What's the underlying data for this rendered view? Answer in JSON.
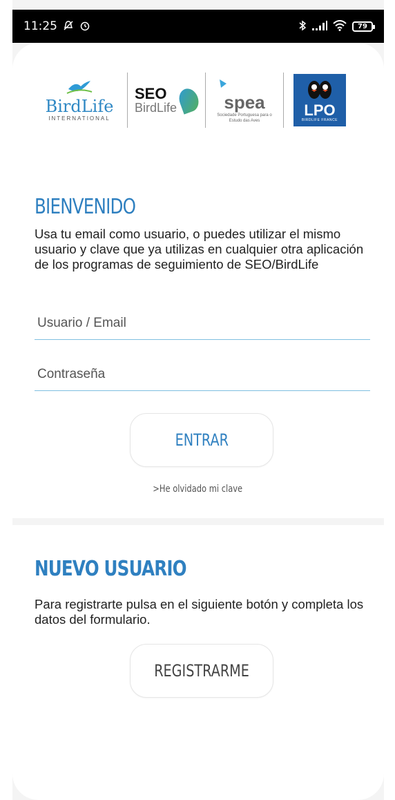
{
  "status_bar": {
    "time": "11:25",
    "battery": "79",
    "icons": [
      "silent-icon",
      "alarm-icon",
      "bluetooth-icon",
      "signal-icon",
      "wifi-icon",
      "battery-icon"
    ]
  },
  "logos": {
    "birdlife": {
      "name": "BirdLife",
      "sub": "INTERNATIONAL"
    },
    "seo": {
      "name": "SEO",
      "sub": "BirdLife"
    },
    "spea": {
      "name": "spea",
      "sub": "Sociedade Portuguesa para o Estudo das Aves"
    },
    "lpo": {
      "name": "LPO",
      "sub": "BIRDLIFE FRANCE"
    }
  },
  "login": {
    "title": "BIENVENIDO",
    "description": "Usa tu email como usuario, o puedes utilizar el mismo usuario y clave que ya utilizas en cualquier otra aplicación de los programas de seguimiento de SEO/BirdLife",
    "username_placeholder": "Usuario / Email",
    "username_value": "",
    "password_placeholder": "Contraseña",
    "password_value": "",
    "submit_label": "ENTRAR",
    "forgot_label": ">He olvidado mi clave"
  },
  "register": {
    "title": "NUEVO USUARIO",
    "description": "Para registrarte pulsa en el siguiente botón y completa los datos del formulario.",
    "button_label": "REGISTRARME"
  },
  "colors": {
    "accent": "#2f80c0",
    "field_underline": "#7fbfe0",
    "background": "#f4f4f4"
  }
}
